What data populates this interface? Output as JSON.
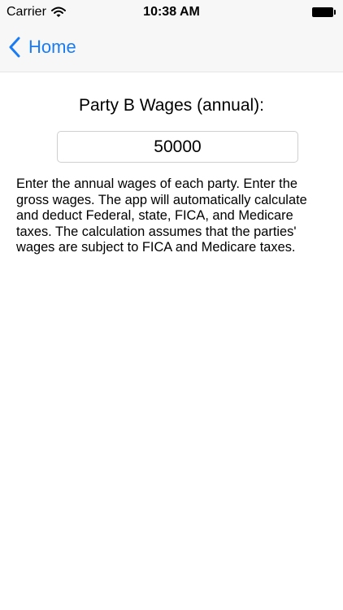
{
  "status_bar": {
    "carrier": "Carrier",
    "time": "10:38 AM"
  },
  "nav": {
    "back_label": "Home"
  },
  "form": {
    "field_title": "Party B Wages (annual):",
    "wage_value": "50000"
  },
  "instructions": "Enter the annual wages of each party. Enter the gross wages. The app will automatically calculate and deduct Federal, state, FICA, and Medicare taxes.  The calculation assumes that the parties' wages are subject to FICA and Medicare taxes.",
  "colors": {
    "accent": "#1a7cf5",
    "bar_background": "#f7f7f7"
  },
  "icons": {
    "wifi": "wifi-icon",
    "battery": "battery-icon",
    "back": "chevron-left-icon"
  }
}
